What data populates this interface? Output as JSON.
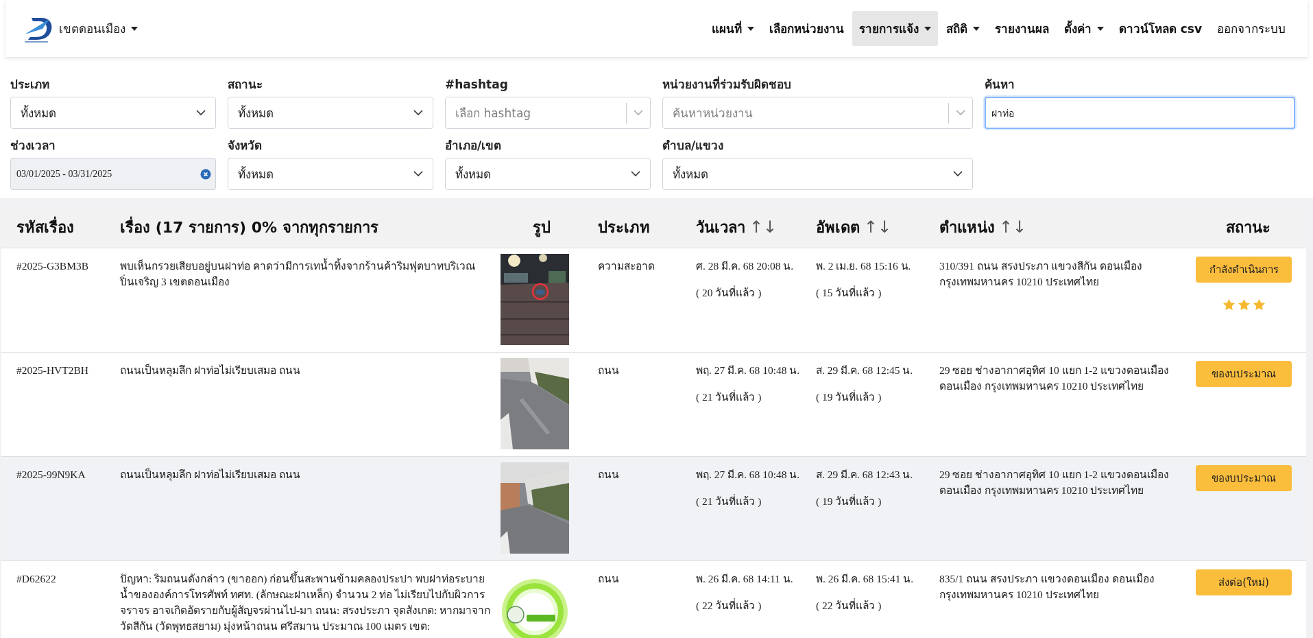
{
  "brand": {
    "label": "เขตดอนเมือง",
    "has_menu": true
  },
  "nav": [
    {
      "label": "แผนที่",
      "has_menu": true,
      "selected": false,
      "kind": "bold"
    },
    {
      "label": "เลือกหน่วยงาน",
      "has_menu": false,
      "selected": false,
      "kind": "bold"
    },
    {
      "label": "รายการแจ้ง",
      "has_menu": true,
      "selected": true,
      "kind": "bold"
    },
    {
      "label": "สถิติ",
      "has_menu": true,
      "selected": false,
      "kind": "bold"
    },
    {
      "label": "รายงานผล",
      "has_menu": false,
      "selected": false,
      "kind": "bold"
    },
    {
      "label": "ตั้งค่า",
      "has_menu": true,
      "selected": false,
      "kind": "bold"
    },
    {
      "label": "ดาวน์โหลด csv",
      "has_menu": false,
      "selected": false,
      "kind": "bold"
    },
    {
      "label": "ออกจากระบบ",
      "has_menu": false,
      "selected": false,
      "kind": "plain"
    }
  ],
  "filters": [
    {
      "label": "ประเภท",
      "kind": "select",
      "value": "ทั้งหมด"
    },
    {
      "label": "สถานะ",
      "kind": "select",
      "value": "ทั้งหมด"
    },
    {
      "label": "#hashtag",
      "kind": "multiselect",
      "placeholder": "เลือก hashtag"
    },
    {
      "label": "หน่วยงานที่ร่วมรับผิดชอบ",
      "kind": "multiselect",
      "placeholder": "ค้นหาหน่วยงาน"
    },
    {
      "label": "ค้นหา",
      "kind": "text",
      "value": "ฝาท่อ",
      "focused": true
    },
    {
      "label": "ช่วงเวลา",
      "kind": "daterange",
      "value": "03/01/2025 - 03/31/2025"
    },
    {
      "label": "จังหวัด",
      "kind": "select",
      "value": "ทั้งหมด"
    },
    {
      "label": "อำเภอ/เขต",
      "kind": "select",
      "value": "ทั้งหมด"
    },
    {
      "label": "ตำบล/แขวง",
      "kind": "select",
      "value": "ทั้งหมด"
    }
  ],
  "table": {
    "columns": [
      {
        "label": "รหัสเรื่อง"
      },
      {
        "label": "เรื่อง (17 รายการ) 0% จากทุกรายการ"
      },
      {
        "label": "รูป"
      },
      {
        "label": "ประเภท"
      },
      {
        "label": "วันเวลา",
        "sort": "↑↓"
      },
      {
        "label": "อัพเดต",
        "sort": "↑↓"
      },
      {
        "label": "ตำแหน่ง",
        "sort": "↑↓"
      },
      {
        "label": "สถานะ"
      }
    ],
    "rows": [
      {
        "code": "#2025-G3BM3B",
        "title": "พบเห็นกรวยเสียบอยู่บนฝาท่อ คาดว่ามีการเทน้ำทิ้งจากร้านค้าริมฟุตบาทบริเวณ ปิ่นเจริญ 3 เขตดอนเมือง",
        "type": "ความสะอาด",
        "created": "ศ. 28 มี.ค. 68 20:08 น.",
        "created_ago": "( 20 วันที่แล้ว )",
        "updated": "พ. 2 เม.ย. 68 15:16 น.",
        "updated_ago": "( 15 วันที่แล้ว )",
        "location": "310/391 ถนน สรงประภา แขวงสีกัน ดอนเมือง กรุงเทพมหานคร 10210 ประเทศไทย",
        "status": "กำลังดำเนินการ",
        "stars": 3,
        "highlighted": false
      },
      {
        "code": "#2025-HVT2BH",
        "title": "ถนนเป็นหลุมลึก ฝาท่อไม่เรียบเสมอ ถนน",
        "type": "ถนน",
        "created": "พฤ. 27 มี.ค. 68 10:48 น.",
        "created_ago": "( 21 วันที่แล้ว )",
        "updated": "ส. 29 มี.ค. 68 12:45 น.",
        "updated_ago": "( 19 วันที่แล้ว )",
        "location": "29 ซอย ช่างอากาศอุทิศ 10 แยก 1-2 แขวงดอนเมือง ดอนเมือง กรุงเทพมหานคร 10210 ประเทศไทย",
        "status": "ของบประมาณ",
        "highlighted": false
      },
      {
        "code": "#2025-99N9KA",
        "title": "ถนนเป็นหลุมลึก ฝาท่อไม่เรียบเสมอ ถนน",
        "type": "ถนน",
        "created": "พฤ. 27 มี.ค. 68 10:48 น.",
        "created_ago": "( 21 วันที่แล้ว )",
        "updated": "ส. 29 มี.ค. 68 12:43 น.",
        "updated_ago": "( 19 วันที่แล้ว )",
        "location": "29 ซอย ช่างอากาศอุทิศ 10 แยก 1-2 แขวงดอนเมือง ดอนเมือง กรุงเทพมหานคร 10210 ประเทศไทย",
        "status": "ของบประมาณ",
        "highlighted": true
      },
      {
        "code": "#D62622",
        "title": "ปัญหา: ริมถนนดังกล่าว (ขาออก) ก่อนขึ้นสะพานข้ามคลองประปา พบฝาท่อระบายน้ำขององค์การโทรศัพท์ ทศท. (ลักษณะฝาเหล็ก) จำนวน 2 ท่อ ไม่เรียบไปกับผิวการจราจร อาจเกิดอัตรายกับผู้สัญจรผ่านไป-มา ถนน: สรงประภา จุดสังเกต: หากมาจากวัดสีกัน (วัดพุทธสยาม) มุ่งหน้าถนน ศรีสมาน ประมาณ 100 เมตร เขต:",
        "type": "ถนน",
        "created": "พ. 26 มี.ค. 68 14:11 น.",
        "created_ago": "( 22 วันที่แล้ว )",
        "updated": "พ. 26 มี.ค. 68 15:41 น.",
        "updated_ago": "( 22 วันที่แล้ว )",
        "location": "835/1 ถนน สรงประภา แขวงดอนเมือง ดอนเมือง กรุงเทพมหานคร 10210 ประเทศไทย",
        "status": "ส่งต่อ(ใหม่)",
        "highlighted": false
      }
    ]
  }
}
